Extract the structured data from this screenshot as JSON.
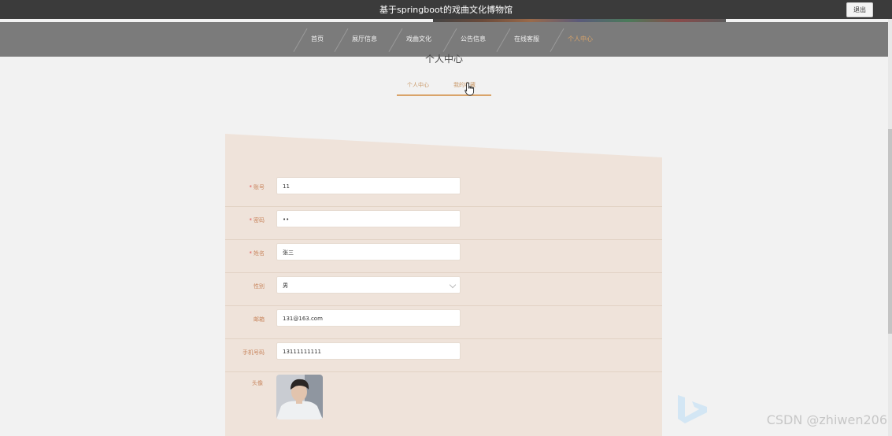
{
  "window": {
    "title": "基于springboot的戏曲文化博物馆",
    "logout_label": "退出"
  },
  "nav": {
    "items": [
      {
        "label": "首页"
      },
      {
        "label": "展厅信息"
      },
      {
        "label": "戏曲文化"
      },
      {
        "label": "公告信息"
      },
      {
        "label": "在线客服"
      },
      {
        "label": "个人中心"
      }
    ],
    "active_index": 5
  },
  "page": {
    "title": "个人中心"
  },
  "tabs": [
    {
      "label": "个人中心"
    },
    {
      "label": "我的收藏"
    }
  ],
  "form": {
    "account": {
      "label": "账号",
      "value": "11",
      "required": true
    },
    "password": {
      "label": "密码",
      "value": "••",
      "required": true
    },
    "name": {
      "label": "姓名",
      "value": "张三",
      "required": true
    },
    "gender": {
      "label": "性别",
      "value": "男",
      "required": false
    },
    "email": {
      "label": "邮箱",
      "value": "131@163.com",
      "required": false
    },
    "phone": {
      "label": "手机号码",
      "value": "13111111111",
      "required": false
    },
    "avatar": {
      "label": "头像"
    }
  },
  "watermark": "CSDN @zhiwen206",
  "colors": {
    "accent": "#d9a46a",
    "nav_bg": "#7b7b7b",
    "topbar_bg": "#3b3b3b",
    "card_bg": "#efe3da"
  }
}
